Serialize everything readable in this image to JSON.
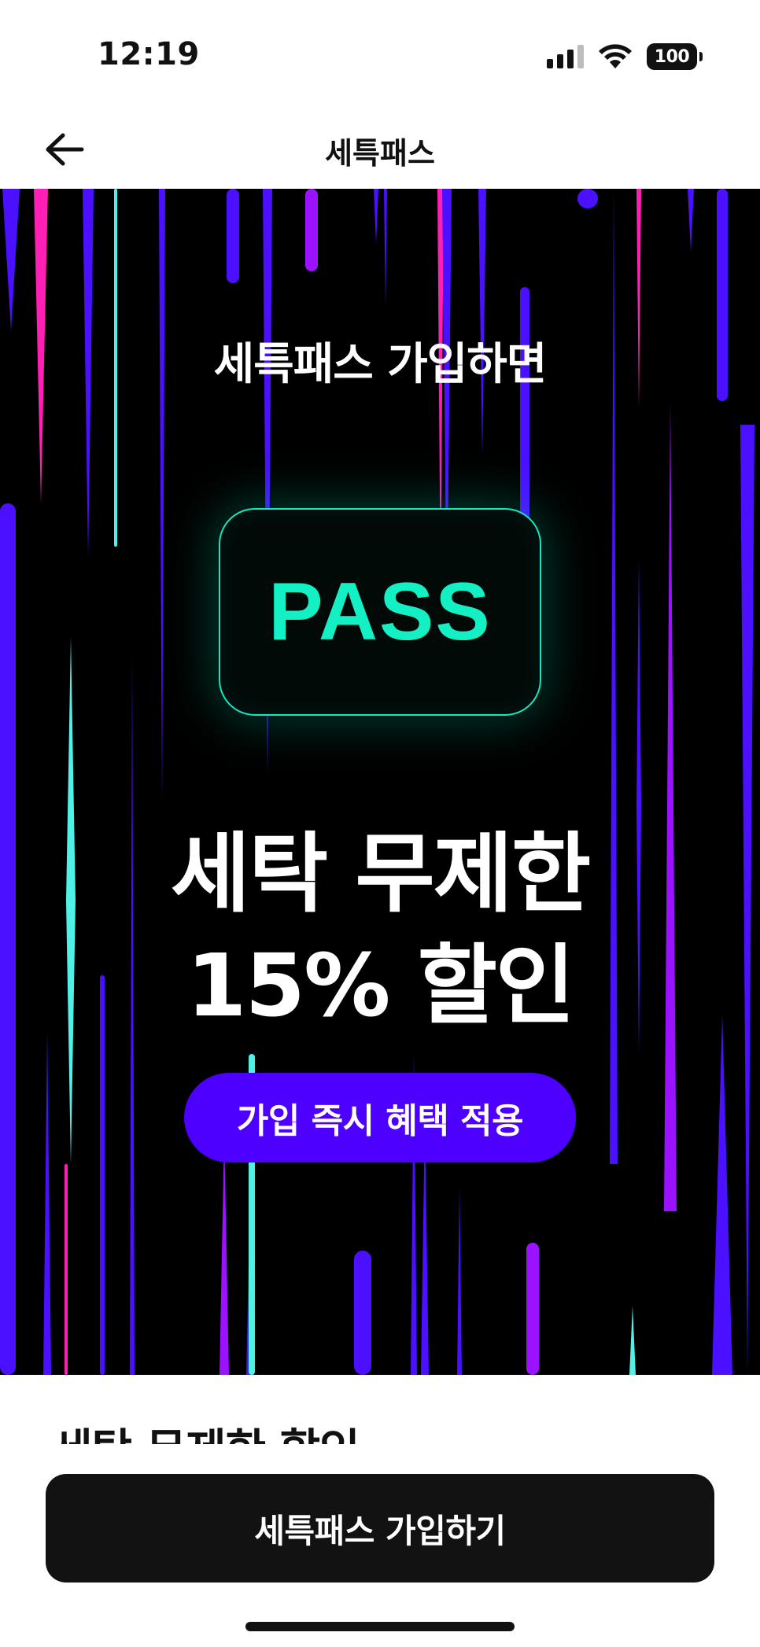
{
  "status_bar": {
    "time": "12:19",
    "battery": "100"
  },
  "nav": {
    "title": "세특패스",
    "back_icon": "arrow-left-icon"
  },
  "hero": {
    "subtitle": "세특패스 가입하면",
    "card_text": "PASS",
    "headline_line1": "세탁 무제한",
    "headline_line2": "15% 할인",
    "pill_label": "가입 즉시 혜택 적용",
    "colors": {
      "background": "#000000",
      "card_accent": "#13f0c4",
      "pill": "#4d00ff",
      "streak_blue": "#4a10ff",
      "streak_purple": "#9a12ff",
      "streak_pink": "#ff1fb4",
      "streak_cyan": "#4ff0e6"
    }
  },
  "section": {
    "title": "세탁 무제한 할인"
  },
  "cta": {
    "label": "세특패스 가입하기"
  }
}
